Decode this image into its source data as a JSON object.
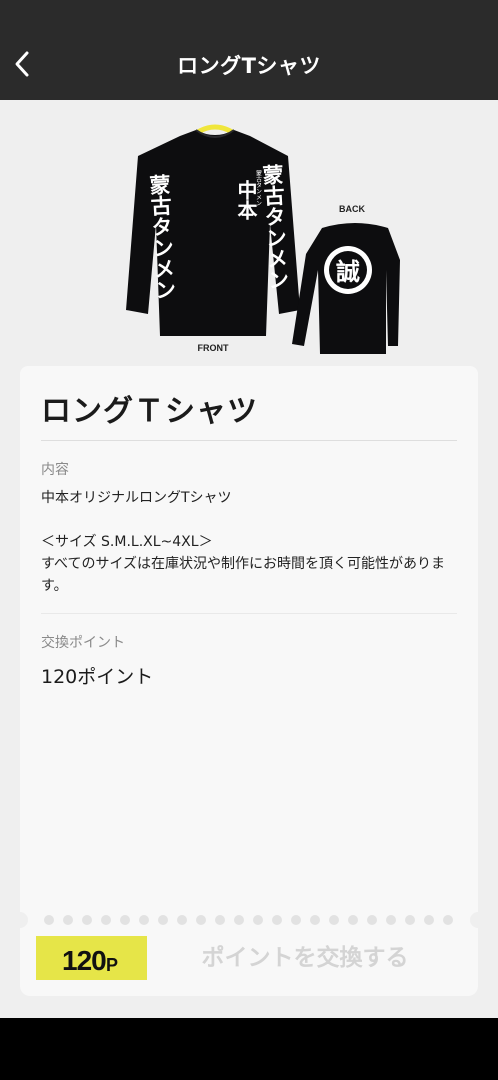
{
  "header": {
    "title": "ロングTシャツ",
    "back_icon": "chevron-left-icon"
  },
  "product_image": {
    "front_label": "FRONT",
    "back_label": "BACK",
    "sleeve_text": "蒙古タンメン",
    "chest_text": "中本",
    "chest_small": "蒙古タンメン",
    "back_emblem": "誠",
    "shirt_color": "#0d0d0f",
    "hanger_color": "#f0e63b"
  },
  "detail": {
    "title": "ロングＴシャツ",
    "contents_label": "内容",
    "description_line1": "中本オリジナルロングTシャツ",
    "description_line2": "＜サイズ S.M.L.XL~4XL＞\nすべてのサイズは在庫状況や制作にお時間を頂く可能性があります。",
    "points_label": "交換ポイント",
    "points_value": "120ポイント"
  },
  "footer": {
    "badge_number": "120",
    "badge_unit": "P",
    "exchange_button": "ポイントを交換する",
    "badge_color": "#e6e548"
  }
}
